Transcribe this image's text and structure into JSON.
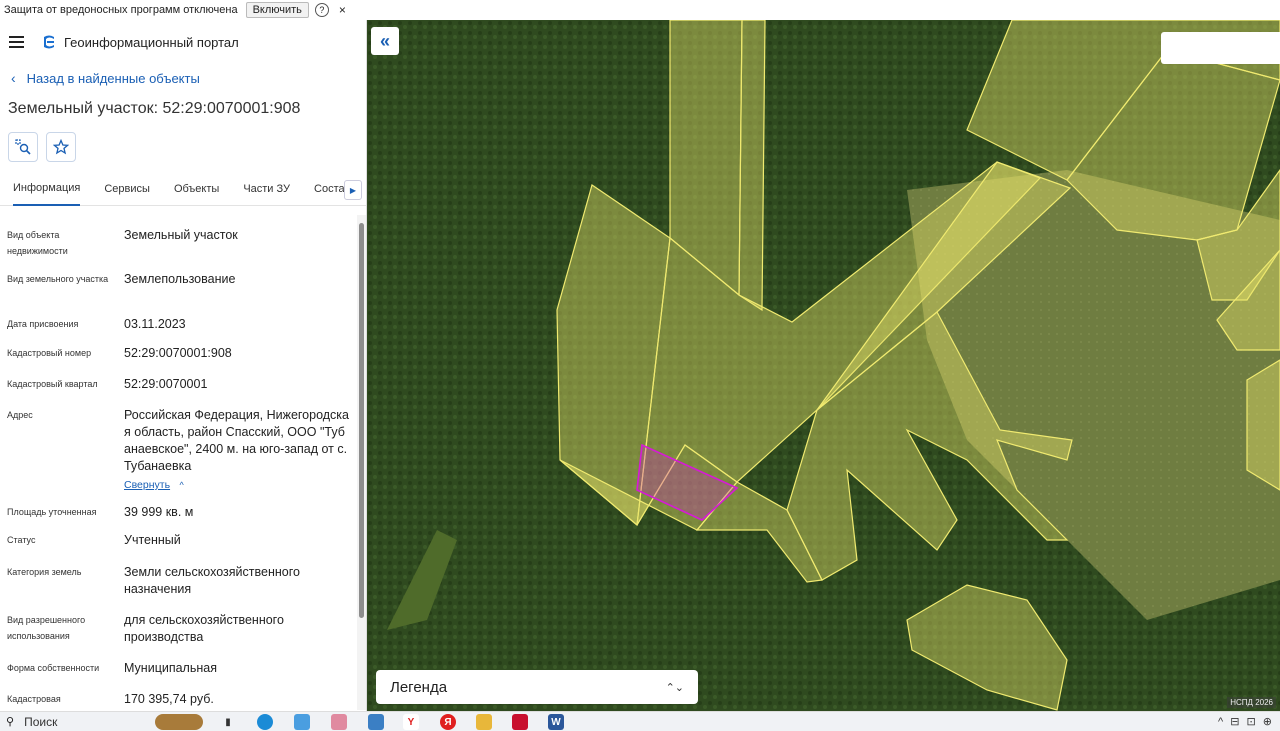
{
  "warning_bar": {
    "text": "Защита от вредоносных программ отключена",
    "enable_button": "Включить",
    "help_icon": "?",
    "close_icon": "×"
  },
  "app": {
    "name": "Геоинформационный портал",
    "back_link": "Назад в найденные объекты",
    "title": "Земельный участок: 52:29:0070001:908"
  },
  "tabs": [
    "Информация",
    "Сервисы",
    "Объекты",
    "Части ЗУ",
    "Состав"
  ],
  "properties": [
    {
      "label": "Вид объекта недвижимости",
      "value": "Земельный участок"
    },
    {
      "label": "Вид земельного участка",
      "value": "Землепользование"
    },
    {
      "label": "Дата присвоения",
      "value": "03.11.2023"
    },
    {
      "label": "Кадастровый номер",
      "value": "52:29:0070001:908"
    },
    {
      "label": "Кадастровый квартал",
      "value": "52:29:0070001"
    },
    {
      "label": "Адрес",
      "value": "Российская Федерация, Нижегородская область, район Спасский, ООО \"Тубанаевское\", 2400 м. на юго-запад от с. Тубанаевка",
      "action": "Свернуть"
    },
    {
      "label": "Площадь уточненная",
      "value": "39 999 кв. м"
    },
    {
      "label": "Статус",
      "value": "Учтенный"
    },
    {
      "label": "Категория земель",
      "value": "Земли сельскохозяйственного назначения"
    },
    {
      "label": "Вид разрешенного использования",
      "value": "для сельскохозяйственного производства"
    },
    {
      "label": "Форма собственности",
      "value": "Муниципальная"
    },
    {
      "label": "Кадастровая",
      "value": "170 395,74 руб."
    }
  ],
  "map": {
    "collapse_icon": "«",
    "legend_label": "Легенда",
    "copyright": "НСПД 2026",
    "colors": {
      "forest": "#2f4a1f",
      "field": "#9aa560",
      "parcel_fill": "#e8e26a",
      "parcel_stroke": "#f0ea70",
      "selected_stroke": "#d61ad6"
    }
  },
  "taskbar": {
    "search_label": "Поиск",
    "search_icon": "search-icon"
  }
}
